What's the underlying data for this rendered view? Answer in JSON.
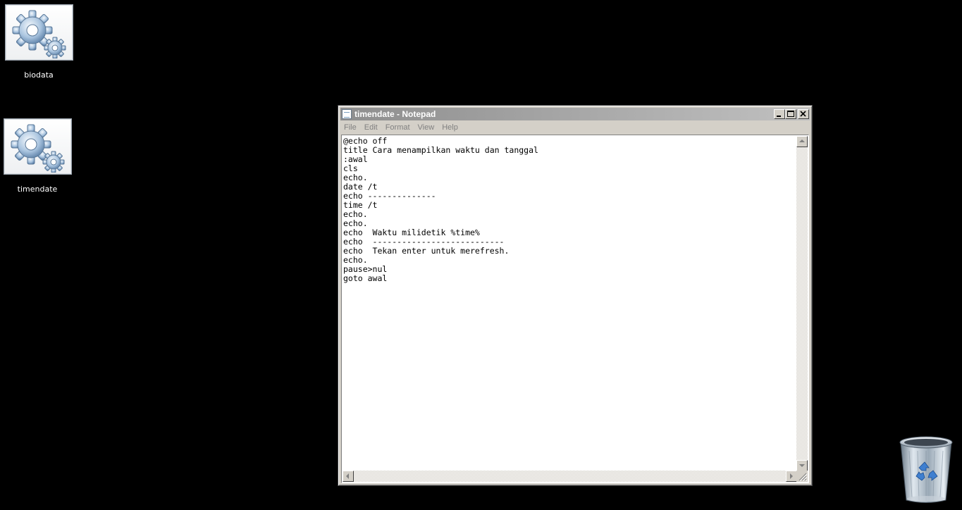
{
  "desktop": {
    "icons": [
      {
        "label": "biodata",
        "icon": "settings-gears-icon"
      },
      {
        "label": "timendate",
        "icon": "settings-gears-icon"
      }
    ],
    "recycle_bin_icon": "recycle-bin-icon"
  },
  "notepad": {
    "title": "timendate - Notepad",
    "menu": {
      "file": "File",
      "edit": "Edit",
      "format": "Format",
      "view": "View",
      "help": "Help"
    },
    "content": "@echo off\ntitle Cara menampilkan waktu dan tanggal\n:awal\ncls\necho.\ndate /t\necho --------------\ntime /t\necho.\necho.\necho  Waktu milidetik %time%\necho  ---------------------------\necho  Tekan enter untuk merefresh.\necho.\npause>nul\ngoto awal"
  },
  "colors": {
    "desktop_background": "#000000",
    "window_face": "#d4d0c8",
    "inactive_title_start": "#8e8e8e",
    "inactive_title_end": "#c0c0c0"
  }
}
